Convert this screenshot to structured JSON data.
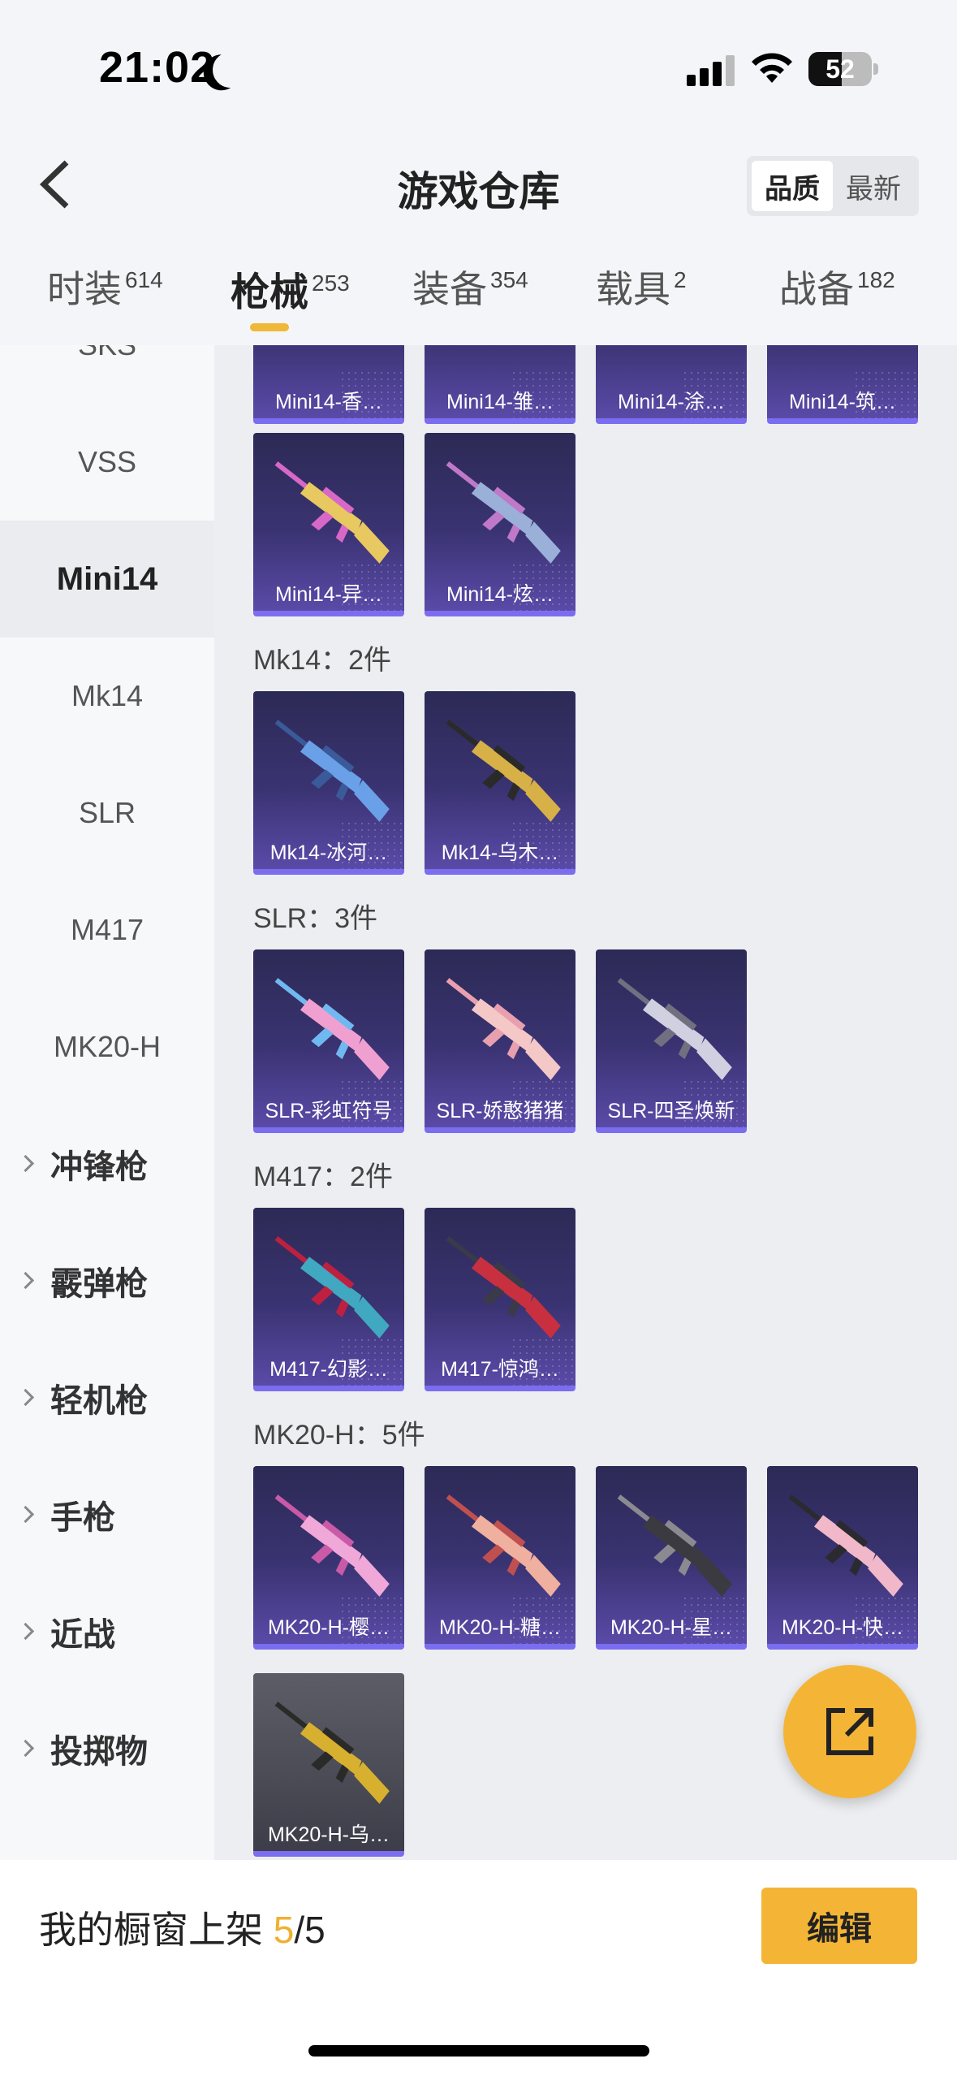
{
  "status_bar": {
    "time": "21:02",
    "battery_level": "52"
  },
  "header": {
    "title": "游戏仓库",
    "sort_options": [
      "品质",
      "最新"
    ],
    "sort_selected": "品质"
  },
  "category_tabs": [
    {
      "label": "时装",
      "count": "614",
      "active": false
    },
    {
      "label": "枪械",
      "count": "253",
      "active": true
    },
    {
      "label": "装备",
      "count": "354",
      "active": false
    },
    {
      "label": "载具",
      "count": "2",
      "active": false
    },
    {
      "label": "战备",
      "count": "182",
      "active": false
    }
  ],
  "sidebar": {
    "items": [
      "SKS",
      "VSS",
      "Mini14",
      "Mk14",
      "SLR",
      "M417",
      "MK20-H"
    ],
    "active_item": "Mini14",
    "groups": [
      "冲锋枪",
      "霰弹枪",
      "轻机枪",
      "手枪",
      "近战",
      "投掷物"
    ]
  },
  "sections": [
    {
      "label": "",
      "items": [
        "Mini14-香…",
        "Mini14-雏…",
        "Mini14-涂…",
        "Mini14-筑…",
        "Mini14-异…",
        "Mini14-炫…"
      ]
    },
    {
      "label": "Mk14：2件",
      "items": [
        "Mk14-冰河…",
        "Mk14-乌木…"
      ]
    },
    {
      "label": "SLR：3件",
      "items": [
        "SLR-彩虹符号",
        "SLR-娇憨猪猪",
        "SLR-四圣焕新"
      ]
    },
    {
      "label": "M417：2件",
      "items": [
        "M417-幻影…",
        "M417-惊鸿…"
      ]
    },
    {
      "label": "MK20-H：5件",
      "items": [
        "MK20-H-樱…",
        "MK20-H-糖…",
        "MK20-H-星…",
        "MK20-H-快…",
        "MK20-H-乌…"
      ]
    }
  ],
  "gun_colors": {
    "Mini14-异…": [
      "#e8c860",
      "#d868c8"
    ],
    "Mini14-炫…": [
      "#9ab0d8",
      "#c078c8"
    ],
    "Mk14-冰河…": [
      "#6aa0e8",
      "#3a5a9a"
    ],
    "Mk14-乌木…": [
      "#d8b048",
      "#2a2a2a"
    ],
    "SLR-彩虹符号": [
      "#f0a0d0",
      "#70b8f0"
    ],
    "SLR-娇憨猪猪": [
      "#f5c8c8",
      "#e8a0b0"
    ],
    "SLR-四圣焕新": [
      "#d0d0e0",
      "#707080"
    ],
    "M417-幻影…": [
      "#40a8c0",
      "#c02040"
    ],
    "M417-惊鸿…": [
      "#c83040",
      "#3a3a4a"
    ],
    "MK20-H-樱…": [
      "#f0a8d8",
      "#c85aa8"
    ],
    "MK20-H-糖…": [
      "#f0b0a0",
      "#c05050"
    ],
    "MK20-H-星…": [
      "#3a3a40",
      "#8a8a90"
    ],
    "MK20-H-快…": [
      "#f0b8c8",
      "#2a2a30"
    ],
    "MK20-H-乌…": [
      "#d8b030",
      "#2a2a28"
    ]
  },
  "bottom_bar": {
    "showcase_label": "我的橱窗上架",
    "showcase_current": "5",
    "showcase_total": "/5",
    "edit_label": "编辑"
  },
  "accent_color": "#f4b536"
}
